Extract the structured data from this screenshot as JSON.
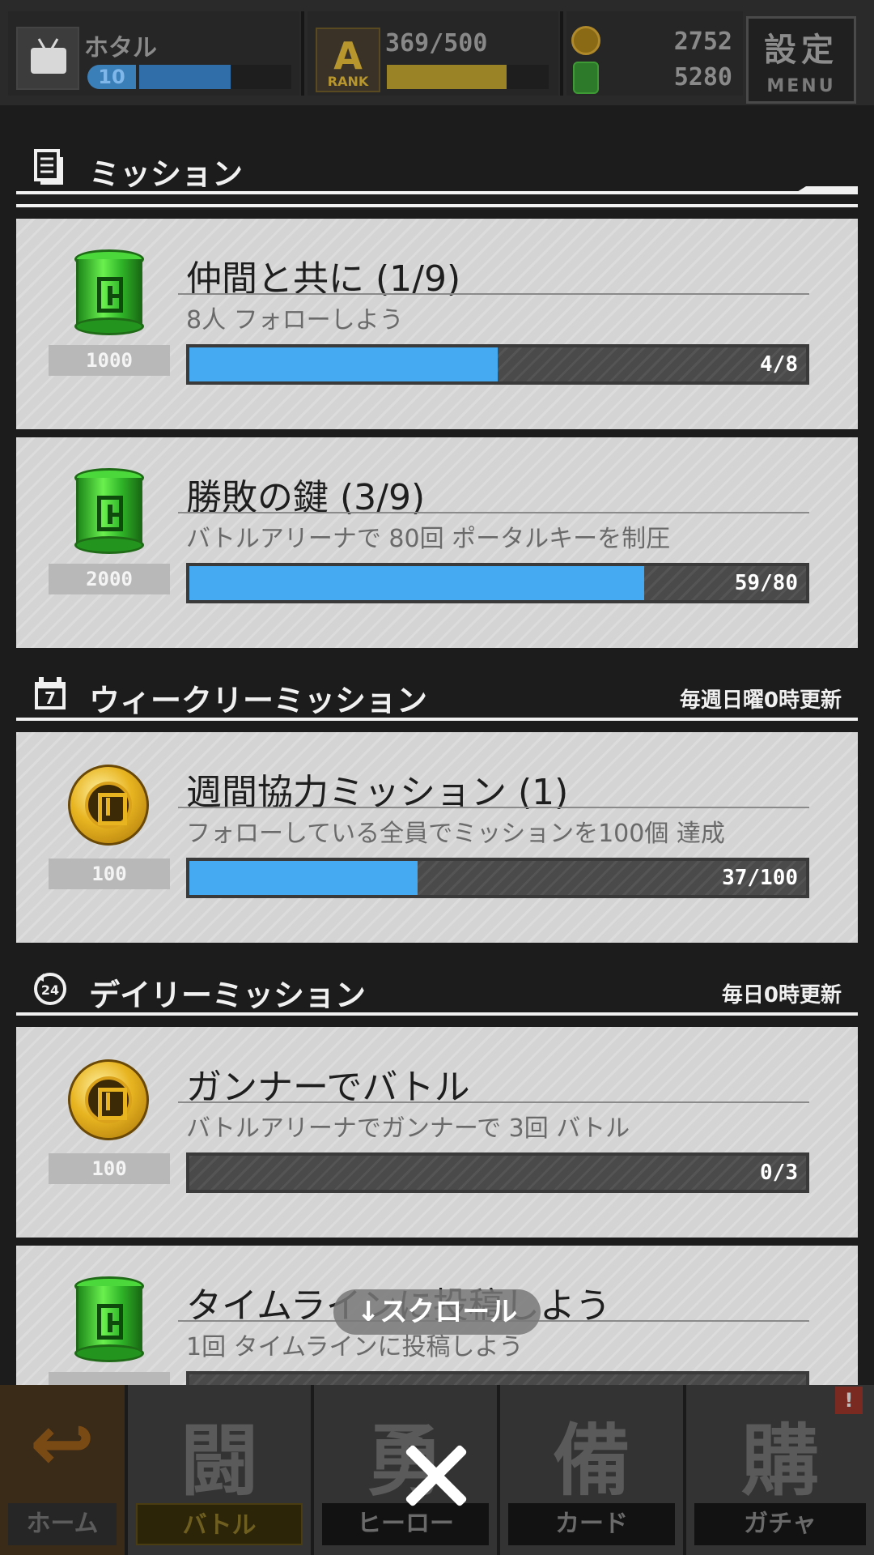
{
  "status": {
    "username": "ホタル",
    "level": "10",
    "level_progress": 0.6,
    "rank_label": "RANK",
    "rank_letter": "A",
    "rank_progress_text": "369/500",
    "rank_progress": 0.74,
    "gold_coins": "2752",
    "green_coins": "5280",
    "menu_kanji": "設定",
    "menu_label": "MENU"
  },
  "sections": {
    "mission": {
      "title": "ミッション"
    },
    "weekly": {
      "title": "ウィークリーミッション",
      "note": "毎週日曜0時更新"
    },
    "daily": {
      "title": "デイリーミッション",
      "note": "毎日0時更新"
    }
  },
  "missions": [
    {
      "reward_icon": "green-can-icon",
      "reward": "1000",
      "title": "仲間と共に (1/9)",
      "desc": "8人 フォローしよう",
      "progress_text": "4/8",
      "progress": 0.5
    },
    {
      "reward_icon": "green-can-icon",
      "reward": "2000",
      "title": "勝敗の鍵 (3/9)",
      "desc": "バトルアリーナで 80回 ポータルキーを制圧",
      "progress_text": "59/80",
      "progress": 0.7375
    },
    {
      "reward_icon": "gold-coin-icon",
      "reward": "100",
      "title": "週間協力ミッション (1)",
      "desc": "フォローしている全員でミッションを100個 達成",
      "progress_text": "37/100",
      "progress": 0.37
    },
    {
      "reward_icon": "gold-coin-icon",
      "reward": "100",
      "title": "ガンナーでバトル",
      "desc": "バトルアリーナでガンナーで 3回 バトル",
      "progress_text": "0/3",
      "progress": 0
    },
    {
      "reward_icon": "green-can-icon",
      "reward": "",
      "title": "タイムラインに投稿しよう",
      "desc": "1回 タイムラインに投稿しよう",
      "progress_text": "",
      "progress": 0
    }
  ],
  "scroll_hint": "↓スクロール",
  "nav": [
    {
      "glyph": "↩",
      "label": "ホーム"
    },
    {
      "glyph": "闘",
      "label": "バトル"
    },
    {
      "glyph": "勇",
      "label": "ヒーロー"
    },
    {
      "glyph": "備",
      "label": "カード"
    },
    {
      "glyph": "購",
      "label": "ガチャ",
      "badge": "!"
    }
  ],
  "colors": {
    "progress_fill": "#46aaf2",
    "card_bg": "#d4d4d4",
    "accent_gold": "#e8b521",
    "accent_green": "#4bd83a"
  }
}
